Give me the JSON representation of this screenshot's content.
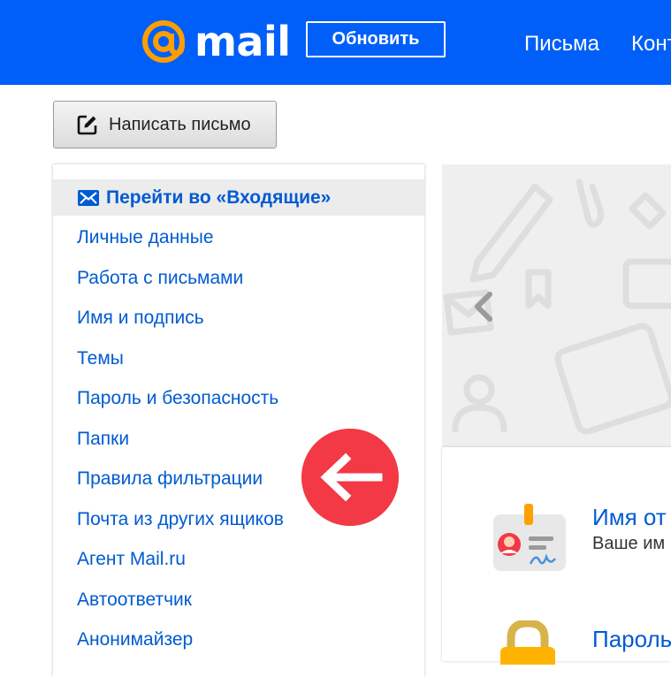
{
  "header": {
    "logo_text": "mail",
    "update_label": "Обновить",
    "nav": [
      "Письма",
      "Контакты"
    ]
  },
  "compose": {
    "label": "Написать письмо"
  },
  "sidebar": {
    "inbox_label": "Перейти во «Входящие»",
    "items": [
      "Личные данные",
      "Работа с письмами",
      "Имя и подпись",
      "Темы",
      "Пароль и безопасность",
      "Папки",
      "Правила фильтрации",
      "Почта из других ящиков",
      "Агент Mail.ru",
      "Автоответчик",
      "Анонимайзер"
    ]
  },
  "cards": [
    {
      "title": "Имя от",
      "desc": "Ваше им"
    },
    {
      "title": "Пароль",
      "desc": ""
    }
  ],
  "colors": {
    "header_bg": "#005ff9",
    "link": "#005bd1",
    "badge": "#f23945",
    "logo_orange": "#ff9e00"
  }
}
